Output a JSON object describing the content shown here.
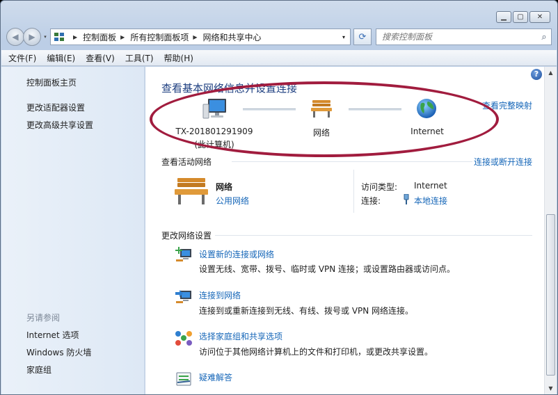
{
  "window": {
    "buttons": {
      "minimize": "▁",
      "maximize": "▢",
      "close": "✕"
    }
  },
  "nav": {
    "back": "◀",
    "forward": "▶",
    "history": "▾",
    "breadcrumbs": [
      "控制面板",
      "所有控制面板项",
      "网络和共享中心"
    ],
    "address_dropdown": "▾",
    "refresh": "⟳",
    "search_placeholder": "搜索控制面板",
    "search_glyph": "⌕"
  },
  "menu": [
    "文件(F)",
    "编辑(E)",
    "查看(V)",
    "工具(T)",
    "帮助(H)"
  ],
  "left": {
    "links": [
      "控制面板主页",
      "更改适配器设置",
      "更改高级共享设置"
    ],
    "see_also_header": "另请参阅",
    "see_also": [
      "Internet 选项",
      "Windows 防火墙",
      "家庭组"
    ]
  },
  "main": {
    "help_glyph": "?",
    "title": "查看基本网络信息并设置连接",
    "full_map": "查看完整映射",
    "nodes": {
      "computer_line1": "TX-201801291909",
      "computer_line2": "(此计算机)",
      "network": "网络",
      "internet": "Internet"
    },
    "active": {
      "header": "查看活动网络",
      "connect_link": "连接或断开连接",
      "network_name": "网络",
      "network_type": "公用网络",
      "access_label": "访问类型:",
      "access_value": "Internet",
      "conn_label": "连接:",
      "conn_value": "本地连接"
    },
    "change": {
      "header": "更改网络设置",
      "tasks": [
        {
          "link": "设置新的连接或网络",
          "desc": "设置无线、宽带、拨号、临时或 VPN 连接；或设置路由器或访问点。"
        },
        {
          "link": "连接到网络",
          "desc": "连接到或重新连接到无线、有线、拨号或 VPN 网络连接。"
        },
        {
          "link": "选择家庭组和共享选项",
          "desc": "访问位于其他网络计算机上的文件和打印机，或更改共享设置。"
        },
        {
          "link": "疑难解答",
          "desc": ""
        }
      ]
    }
  },
  "scrollbar": {
    "up": "▲",
    "down": "▼"
  },
  "colors": {
    "link": "#1566b8",
    "title": "#1e3f80",
    "annotation": "#a11c3e"
  }
}
